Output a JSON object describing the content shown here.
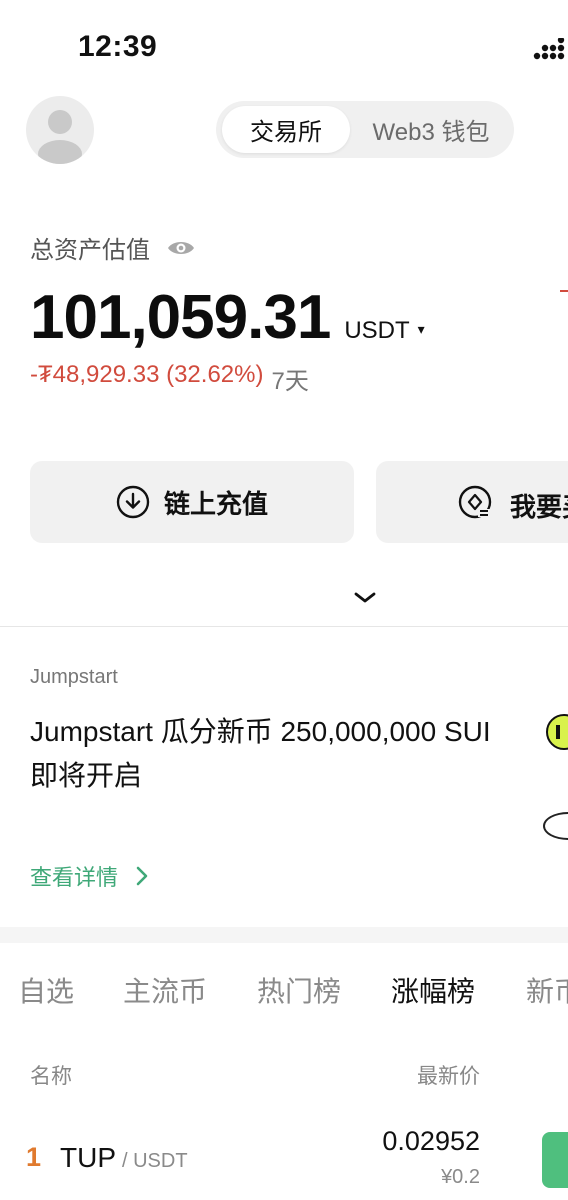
{
  "status_bar": {
    "time": "12:39",
    "signal_icon": "signal-dots-icon"
  },
  "header": {
    "avatar_icon": "user-avatar-icon",
    "segment": {
      "active": "交易所",
      "inactive": "Web3 钱包"
    }
  },
  "assets": {
    "label": "总资产估值",
    "visibility_icon": "eye-icon",
    "balance": "101,059.31",
    "currency": "USDT",
    "currency_caret": "▾",
    "change": "-₮48,929.33 (32.62%)",
    "period": "7天"
  },
  "actions": {
    "deposit_label": "链上充值",
    "deposit_icon": "download-icon",
    "second_label": "我要买",
    "second_icon": "buy-coin-icon"
  },
  "jumpstart": {
    "tag": "Jumpstart",
    "title": "Jumpstart 瓜分新币 250,000,000 SUI 即将开启",
    "link": "查看详情"
  },
  "market": {
    "tabs": [
      "自选",
      "主流币",
      "热门榜",
      "涨幅榜",
      "新币"
    ],
    "active_tab": "涨幅榜",
    "columns": {
      "name": "名称",
      "price": "最新价"
    },
    "rows": [
      {
        "rank": "1",
        "symbol": "TUP",
        "pair": "/ USDT",
        "price": "0.02952",
        "price_cny": "¥0.2"
      }
    ]
  },
  "colors": {
    "negative": "#d14b3d",
    "positive": "#4fbf7e",
    "link": "#3fa878",
    "rank": "#e07a2e"
  }
}
